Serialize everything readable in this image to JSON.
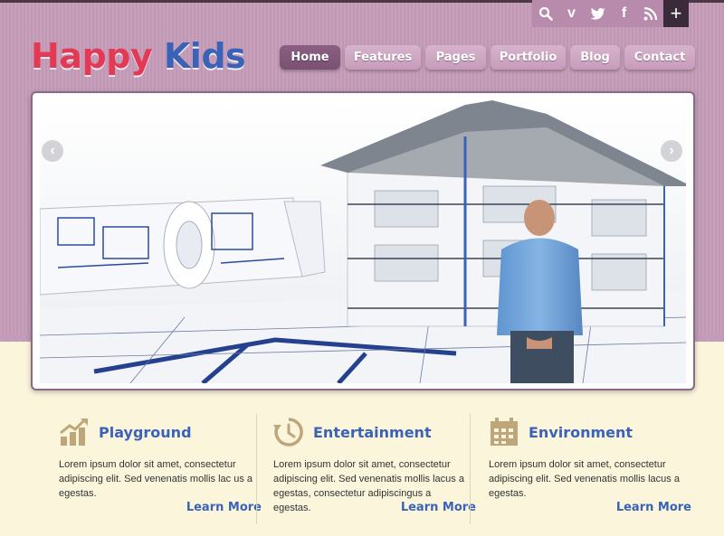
{
  "brand": {
    "word1": "Happy",
    "word2": "Kids"
  },
  "social": [
    {
      "icon": "search-icon",
      "glyph": "⚲"
    },
    {
      "icon": "vimeo-icon",
      "glyph": "v"
    },
    {
      "icon": "twitter-icon",
      "glyph": "❧"
    },
    {
      "icon": "facebook-icon",
      "glyph": "f"
    },
    {
      "icon": "rss-icon",
      "glyph": "◣"
    },
    {
      "icon": "plus-icon",
      "glyph": "+"
    }
  ],
  "nav": [
    "Home",
    "Features",
    "Pages",
    "Portfolio",
    "Blog",
    "Contact"
  ],
  "slider": {
    "prev": "‹",
    "next": "›"
  },
  "features": [
    {
      "icon": "chart-icon",
      "title": "Playground",
      "text": "Lorem ipsum dolor sit amet, consectetur adipiscing elit. Sed venenatis mollis lac us a egestas.",
      "link": "Learn More"
    },
    {
      "icon": "history-clock-icon",
      "title": "Entertainment",
      "text": "Lorem ipsum dolor sit amet, consectetur adipiscing elit. Sed venenatis mollis lacus a egestas, consectetur adipiscingus a egestas.",
      "link": "Learn More"
    },
    {
      "icon": "calendar-icon",
      "title": "Environment",
      "text": "Lorem ipsum dolor sit amet, consectetur adipiscing elit. Sed venenatis mollis lacus a egestas.",
      "link": "Learn More"
    }
  ],
  "colors": {
    "header_bg": "#c49bb8",
    "page_bg": "#fbf5dc",
    "accent_blue": "#3a63b8",
    "accent_red": "#e23a55",
    "nav_active": "#7a5073",
    "icon_tan": "#bfa57a"
  }
}
